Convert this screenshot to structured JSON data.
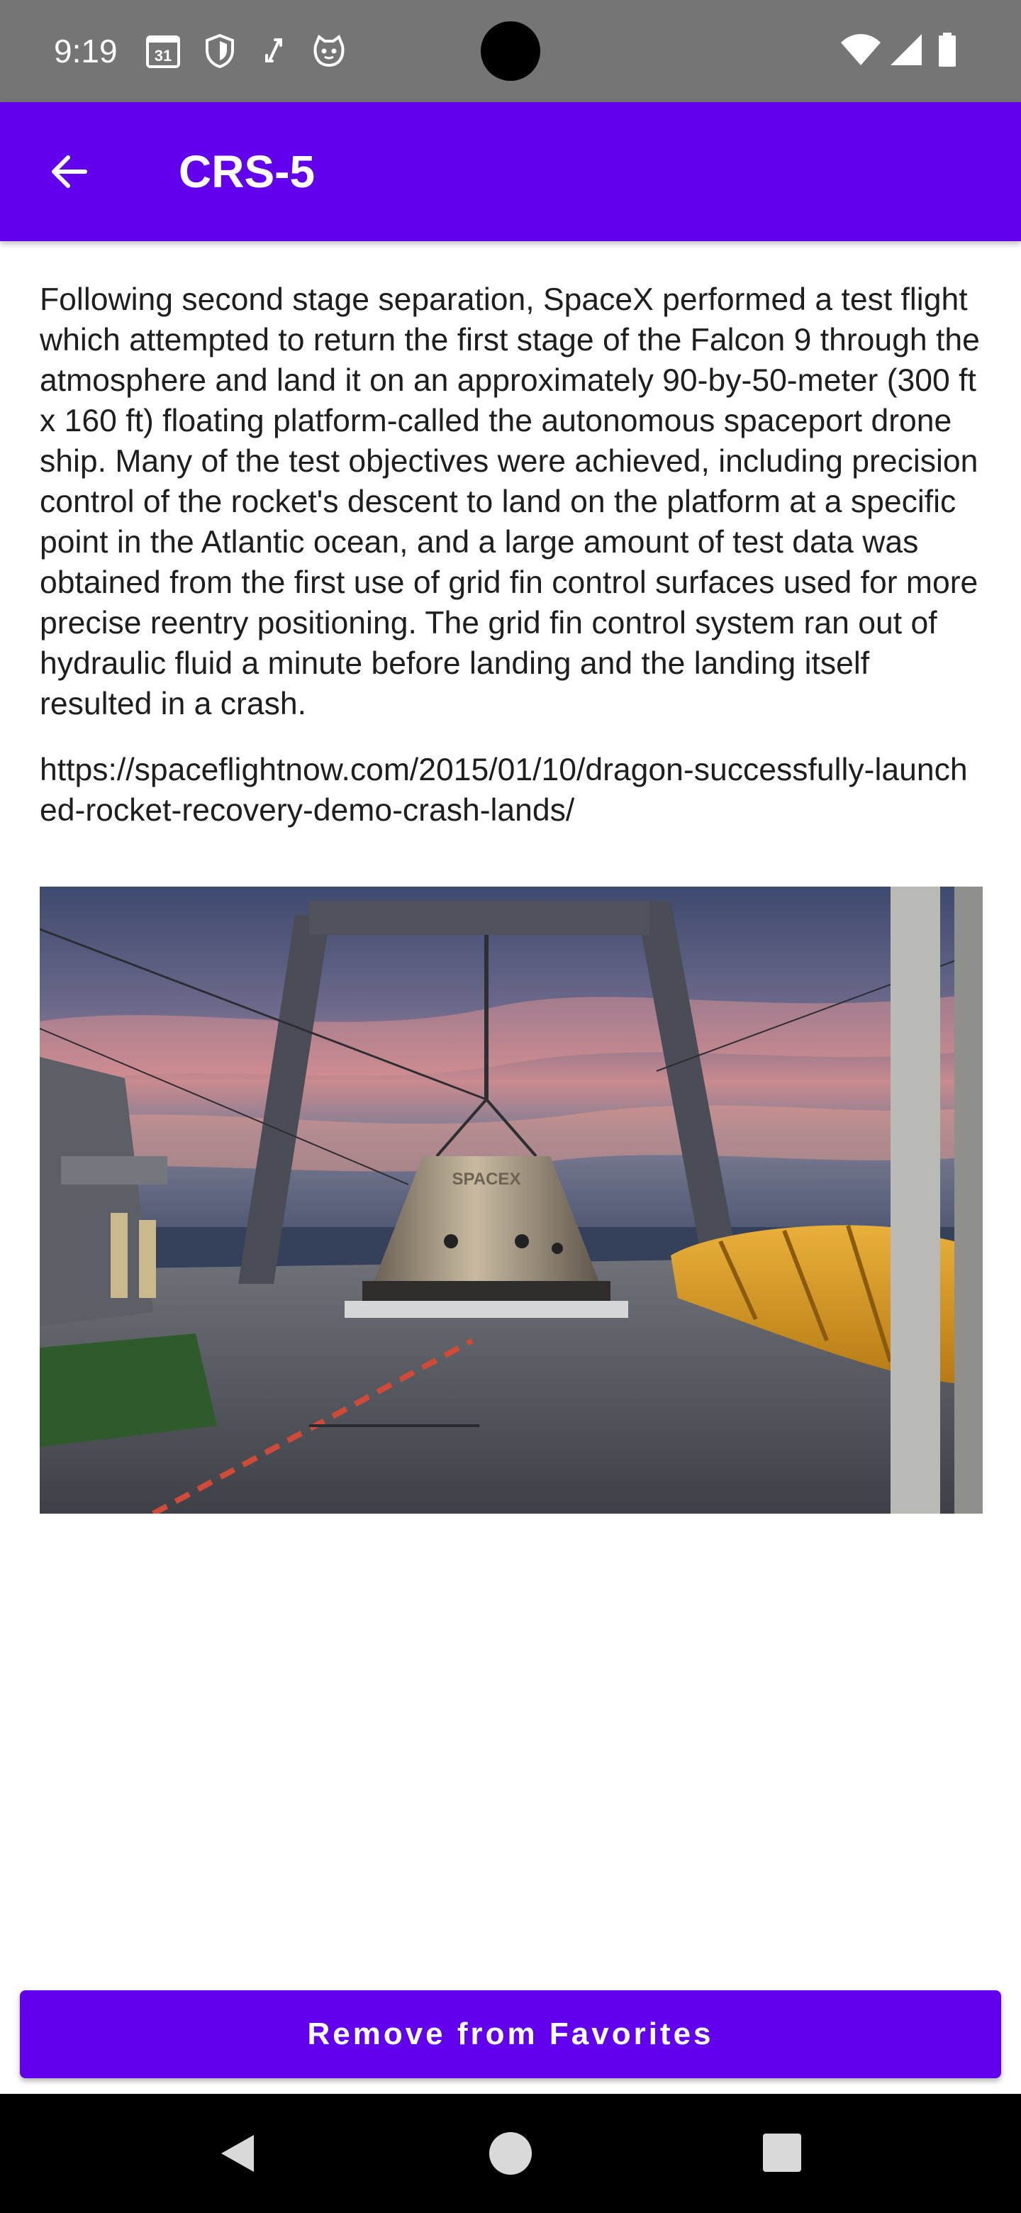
{
  "status_bar": {
    "time": "9:19",
    "left_icons": [
      "calendar-icon",
      "shield-icon",
      "sync-icon",
      "cat-icon"
    ],
    "calendar_day": "31",
    "right_icons": [
      "wifi-icon",
      "signal-icon",
      "battery-icon"
    ]
  },
  "app_bar": {
    "title": "CRS-5",
    "back_icon": "arrow-back-icon",
    "background_color": "#6200ee"
  },
  "content": {
    "description": "Following second stage separation, SpaceX performed a test flight which attempted to return the first stage of the Falcon 9 through the atmosphere and land it on an approximately 90-by-50-meter (300 ft x 160 ft) floating platform-called the autonomous spaceport drone ship. Many of the test objectives were achieved, including precision control of the rocket's descent to land on the platform at a specific point in the Atlantic ocean, and a large amount of test data was obtained from the first use of grid fin control surfaces used for more precise reentry positioning. The grid fin control system ran out of hydraulic fluid a minute before landing and the landing itself resulted in a crash.",
    "article_link": "https://spaceflightnow.com/2015/01/10/dragon-successfully-launched-rocket-recovery-demo-crash-lands/",
    "photo_logo_text": "SPACEX"
  },
  "actions": {
    "remove_favorites_label": "Remove from Favorites"
  },
  "nav_bar": {
    "icons": [
      "nav-back-icon",
      "nav-home-icon",
      "nav-recents-icon"
    ]
  },
  "colors": {
    "primary": "#6200ee",
    "status_bar": "#757575",
    "nav_bar": "#000000",
    "text": "#1e1e1e"
  }
}
